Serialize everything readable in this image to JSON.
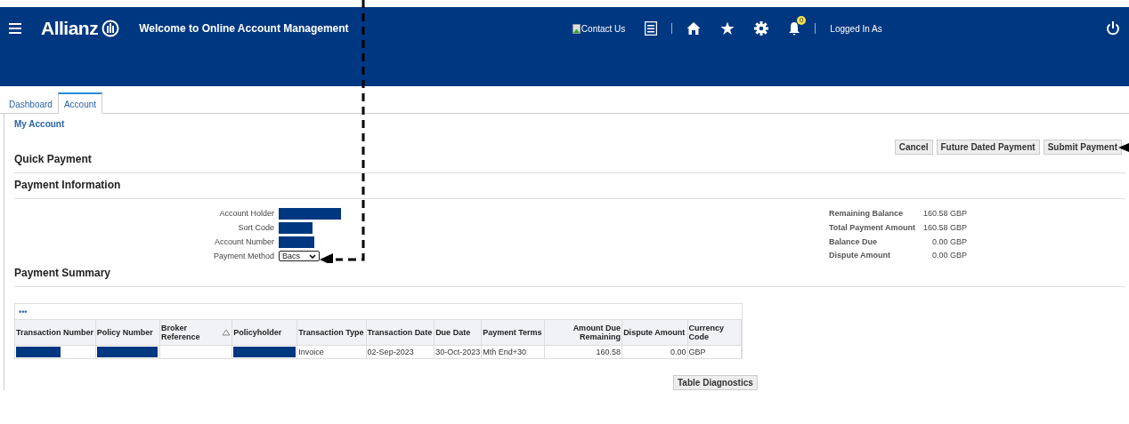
{
  "header": {
    "brand": "Allianz",
    "title": "Welcome to Online Account Management",
    "contact": "Contact Us",
    "notifications": "0",
    "user": "Logged In As"
  },
  "tabs": [
    {
      "label": "Dashboard",
      "selected": false
    },
    {
      "label": "Account",
      "selected": true
    }
  ],
  "breadcrumb": "My Account",
  "buttons": [
    "Cancel",
    "Future Dated Payment",
    "Submit Payment"
  ],
  "sections": {
    "quick": "Quick Payment",
    "info": "Payment Information",
    "summary": "Payment Summary"
  },
  "fields": [
    {
      "label": "Account Holder",
      "kind": "redacted"
    },
    {
      "label": "Sort Code",
      "kind": "redacted"
    },
    {
      "label": "Account Number",
      "kind": "redacted"
    },
    {
      "label": "Payment Method",
      "kind": "select",
      "value": "Bacs"
    }
  ],
  "totals": [
    {
      "label": "Remaining Balance",
      "value": "160.58 GBP"
    },
    {
      "label": "Total Payment Amount",
      "value": "160.58 GBP"
    },
    {
      "label": "Balance Due",
      "value": "0.00 GBP"
    },
    {
      "label": "Dispute Amount",
      "value": "0.00 GBP"
    }
  ],
  "table": {
    "toolbar": "•••",
    "columns": [
      {
        "label": "Transaction Number",
        "sorted": false
      },
      {
        "label": "Policy Number",
        "sorted": false
      },
      {
        "label": "Broker Reference",
        "sorted": true
      },
      {
        "label": "Policyholder",
        "sorted": false
      },
      {
        "label": "Transaction Type",
        "sorted": false
      },
      {
        "label": "Transaction Date",
        "sorted": false
      },
      {
        "label": "Due Date",
        "sorted": false
      },
      {
        "label": "Payment Terms",
        "sorted": false
      },
      {
        "label": "Amount Due Remaining",
        "sorted": false
      },
      {
        "label": "Dispute Amount",
        "sorted": false
      },
      {
        "label": "Currency Code",
        "sorted": false
      }
    ],
    "rows": [
      {
        "cells": [
          {
            "kind": "redacted"
          },
          {
            "kind": "redacted"
          },
          {
            "kind": "blank"
          },
          {
            "kind": "redacted"
          },
          {
            "kind": "text",
            "text": "Invoice"
          },
          {
            "kind": "text",
            "text": "02-Sep-2023"
          },
          {
            "kind": "text",
            "text": "30-Oct-2023"
          },
          {
            "kind": "text",
            "text": "Mth End+30"
          },
          {
            "kind": "number",
            "text": "160.58"
          },
          {
            "kind": "number",
            "text": "0.00"
          },
          {
            "kind": "text",
            "text": "GBP"
          }
        ]
      }
    ]
  },
  "diagnostics": "Table Diagnostics"
}
